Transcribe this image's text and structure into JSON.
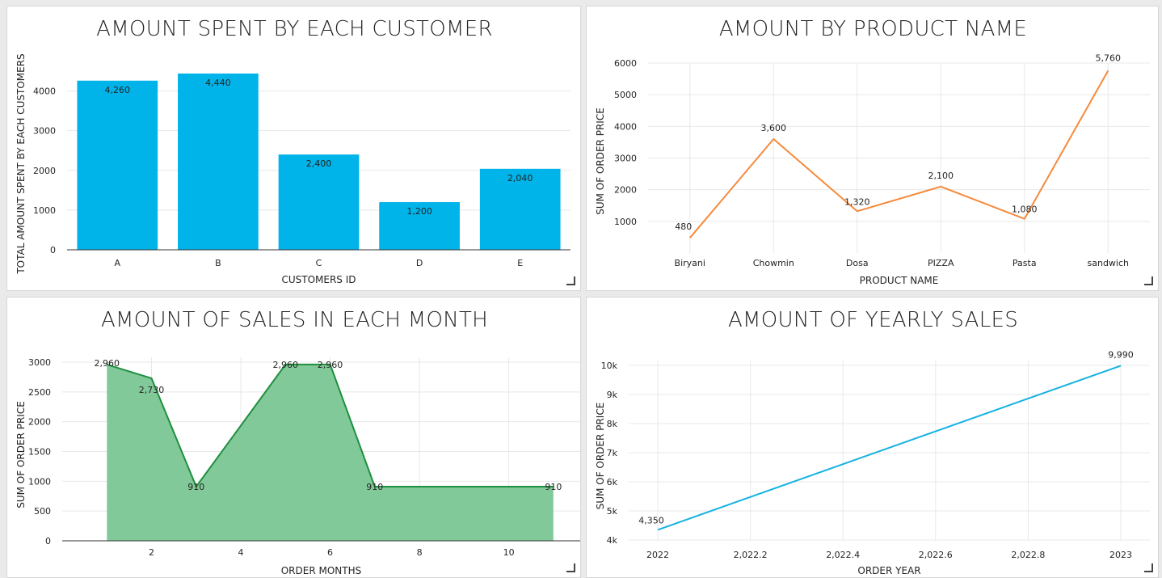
{
  "chart_data": [
    {
      "id": "p1",
      "type": "bar",
      "title": "AMOUNT SPENT BY EACH CUSTOMER",
      "xlabel": "CUSTOMERS ID",
      "ylabel": "TOTAL AMOUNT SPENT BY EACH CUSTOMERS",
      "categories": [
        "A",
        "B",
        "C",
        "D",
        "E"
      ],
      "values": [
        4260,
        4440,
        2400,
        1200,
        2040
      ],
      "data_labels": [
        "4,260",
        "4,440",
        "2,400",
        "1,200",
        "2,040"
      ],
      "ylim": [
        0,
        4500
      ],
      "yticks": [
        0,
        1000,
        2000,
        3000,
        4000
      ],
      "ytick_labels": [
        "0",
        "1000",
        "2000",
        "3000",
        "4000"
      ],
      "color": "#00b3e8",
      "grid": true
    },
    {
      "id": "p2",
      "type": "line",
      "title": "AMOUNT BY PRODUCT NAME",
      "xlabel": "PRODUCT NAME",
      "ylabel": "SUM OF ORDER PRICE",
      "categories": [
        "Biryani",
        "Chowmin",
        "Dosa",
        "PIZZA",
        "Pasta",
        "sandwich"
      ],
      "values": [
        480,
        3600,
        1320,
        2100,
        1080,
        5760
      ],
      "data_labels": [
        "480",
        "3,600",
        "1,320",
        "2,100",
        "1,080",
        "5,760"
      ],
      "ylim": [
        0,
        6000
      ],
      "yticks": [
        1000,
        2000,
        3000,
        4000,
        5000,
        6000
      ],
      "ytick_labels": [
        "1000",
        "2000",
        "3000",
        "4000",
        "5000",
        "6000"
      ],
      "color": "#f58a3c",
      "grid": true
    },
    {
      "id": "p3",
      "type": "area",
      "title": "AMOUNT OF SALES IN EACH MONTH",
      "xlabel": "ORDER MONTHS",
      "ylabel": "SUM OF ORDER PRICE",
      "x": [
        1,
        2,
        3,
        5,
        6,
        7,
        11
      ],
      "values": [
        2960,
        2730,
        910,
        2960,
        2960,
        910,
        910
      ],
      "data_labels": [
        "2,960",
        "2,730",
        "910",
        "2,960",
        "2,960",
        "910",
        "910"
      ],
      "xlim": [
        0,
        11.6
      ],
      "xticks": [
        2,
        4,
        6,
        8,
        10
      ],
      "xtick_labels": [
        "2",
        "4",
        "6",
        "8",
        "10"
      ],
      "ylim": [
        0,
        3000
      ],
      "yticks": [
        0,
        500,
        1000,
        1500,
        2000,
        2500,
        3000
      ],
      "ytick_labels": [
        "0",
        "500",
        "1000",
        "1500",
        "2000",
        "2500",
        "3000"
      ],
      "color": "#1e8f3e",
      "fill_color": "#82c99a",
      "grid": true
    },
    {
      "id": "p4",
      "type": "line",
      "title": "AMOUNT OF YEARLY SALES",
      "xlabel": "ORDER YEAR",
      "ylabel": "SUM OF ORDER PRICE",
      "x": [
        2022,
        2023
      ],
      "values": [
        4350,
        9990
      ],
      "data_labels": [
        "4,350",
        "9,990"
      ],
      "xlim": [
        2022,
        2023
      ],
      "xticks": [
        2022,
        2022.2,
        2022.4,
        2022.6,
        2022.8,
        2023
      ],
      "xtick_labels": [
        "2022",
        "2,022.2",
        "2,022.4",
        "2,022.6",
        "2,022.8",
        "2023"
      ],
      "ylim": [
        4000,
        10000
      ],
      "yticks": [
        4000,
        5000,
        6000,
        7000,
        8000,
        9000,
        10000
      ],
      "ytick_labels": [
        "4k",
        "5k",
        "6k",
        "7k",
        "8k",
        "9k",
        "10k"
      ],
      "color": "#16b2e2",
      "grid": true
    }
  ]
}
